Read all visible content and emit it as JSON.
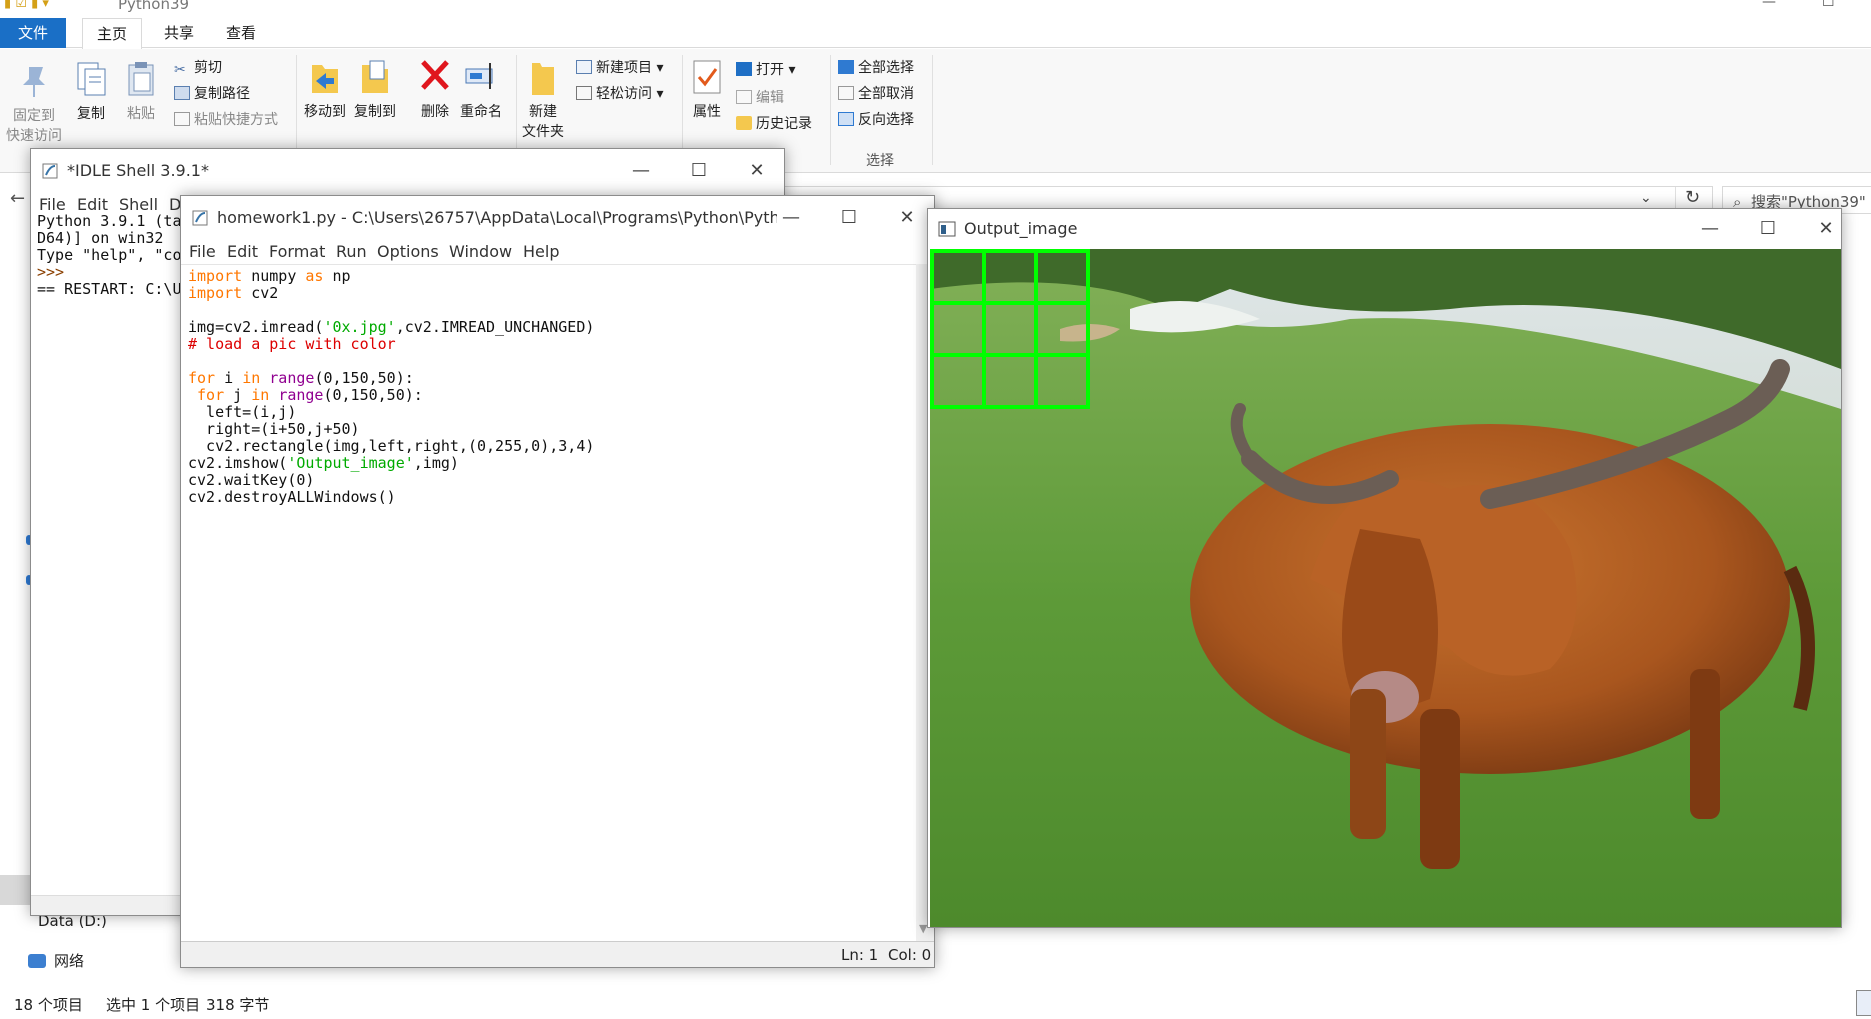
{
  "explorer": {
    "title": "Python39",
    "tabs": {
      "file": "文件",
      "home": "主页",
      "share": "共享",
      "view": "查看"
    },
    "ribbon": {
      "pin_line1": "固定到",
      "pin_line2": "快速访问",
      "copy": "复制",
      "paste": "粘贴",
      "cut": "剪切",
      "copy_path": "复制路径",
      "paste_shortcut": "粘贴快捷方式",
      "move_to": "移动到",
      "copy_to": "复制到",
      "delete": "删除",
      "rename": "重命名",
      "new_folder_line1": "新建",
      "new_folder_line2": "文件夹",
      "new_item": "新建项目",
      "easy_access": "轻松访问",
      "properties": "属性",
      "open": "打开",
      "edit": "编辑",
      "history": "历史记录",
      "select_all": "全部选择",
      "select_none": "全部取消",
      "invert_selection": "反向选择",
      "group_select": "选择"
    },
    "search_placeholder": "搜索\"Python39\"",
    "nav": {
      "data_drive": "Data (D:)",
      "network": "网络"
    },
    "status": {
      "item_count": "18 个项目",
      "selected": "选中 1 个项目",
      "size": "318 字节"
    }
  },
  "idle_shell": {
    "title": "*IDLE Shell 3.9.1*",
    "menu": [
      "File",
      "Edit",
      "Shell",
      "D"
    ],
    "lines": {
      "l1": "Python 3.9.1 (ta",
      "l2": "D64)] on win32",
      "l3": "Type \"help\", \"co",
      "l4": ">>>",
      "l5": "== RESTART: C:\\U"
    }
  },
  "editor": {
    "title": "homework1.py - C:\\Users\\26757\\AppData\\Local\\Programs\\Python\\Pytho...",
    "menu": [
      "File",
      "Edit",
      "Format",
      "Run",
      "Options",
      "Window",
      "Help"
    ],
    "code": {
      "l1_kw": "import",
      "l1_rest": " numpy ",
      "l1_as": "as",
      "l1_np": " np",
      "l2_kw": "import",
      "l2_rest": " cv2",
      "l4_a": "img=cv2.imread(",
      "l4_str": "'0x.jpg'",
      "l4_b": ",cv2.IMREAD_UNCHANGED)",
      "l5_comment": "# load a pic with color",
      "l7_for": "for",
      "l7_i": " i ",
      "l7_in": "in",
      "l7_sp": " ",
      "l7_range": "range",
      "l7_args": "(0,150,50):",
      "l8_ind": " ",
      "l8_for": "for",
      "l8_j": " j ",
      "l8_in": "in",
      "l8_sp": " ",
      "l8_range": "range",
      "l8_args": "(0,150,50):",
      "l9": "  left=(i,j)",
      "l10": "  right=(i+50,j+50)",
      "l11": "  cv2.rectangle(img,left,right,(0,255,0),3,4)",
      "l12_a": "cv2.imshow(",
      "l12_str": "'Output_image'",
      "l12_b": ",img)",
      "l13": "cv2.waitKey(0)",
      "l14": "cv2.destroyALLWindows()"
    },
    "status": {
      "ln": "Ln: 1",
      "col": "Col: 0"
    }
  },
  "output_window": {
    "title": "Output_image",
    "grid": {
      "rows": 3,
      "cols": 3,
      "color": "#00ff00"
    }
  },
  "colors": {
    "accent": "#1a6fc6",
    "keyword": "#ff7700",
    "builtin": "#900090",
    "string": "#00aa00",
    "comment": "#dd0000"
  }
}
